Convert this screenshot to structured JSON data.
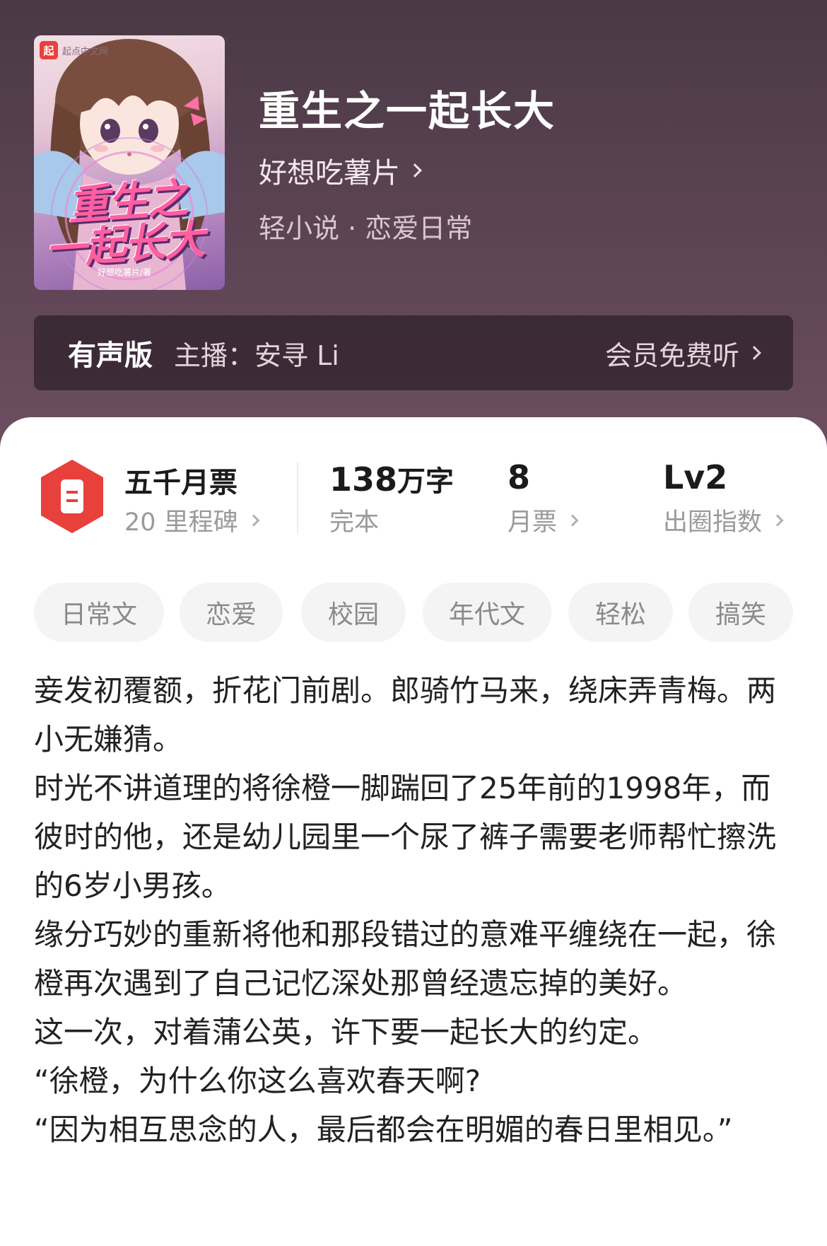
{
  "book": {
    "title": "重生之一起长大",
    "author": "好想吃薯片",
    "genre": "轻小说 · 恋爱日常",
    "cover": {
      "badge": "起",
      "badge_text": "起点中文网",
      "title_line1": "重生之",
      "title_line2": "一起长大",
      "author_tag": "好想吃薯片/著"
    }
  },
  "audio": {
    "label": "有声版",
    "host": "主播：安寻 Li",
    "cta": "会员免费听"
  },
  "stats": {
    "milestone_title": "五千月票",
    "milestone_sub": "20 里程碑",
    "words_value": "138",
    "words_unit": "万字",
    "words_status": "完本",
    "tickets_value": "8",
    "tickets_label": "月票",
    "level_value": "Lv2",
    "level_label": "出圈指数"
  },
  "tags": [
    "日常文",
    "恋爱",
    "校园",
    "年代文",
    "轻松",
    "搞笑"
  ],
  "description": [
    "妾发初覆额，折花门前剧。郎骑竹马来，绕床弄青梅。两小无嫌猜。",
    "时光不讲道理的将徐橙一脚踹回了25年前的1998年，而彼时的他，还是幼儿园里一个尿了裤子需要老师帮忙擦洗的6岁小男孩。",
    "缘分巧妙的重新将他和那段错过的意难平缠绕在一起，徐橙再次遇到了自己记忆深处那曾经遗忘掉的美好。",
    "这一次，对着蒲公英，许下要一起长大的约定。",
    "“徐橙，为什么你这么喜欢春天啊?",
    "“因为相互思念的人，最后都会在明媚的春日里相见。”"
  ],
  "colors": {
    "header_bg": "#5a4252",
    "ticket_red": "#e8403a",
    "tag_bg": "#f4f4f4"
  }
}
